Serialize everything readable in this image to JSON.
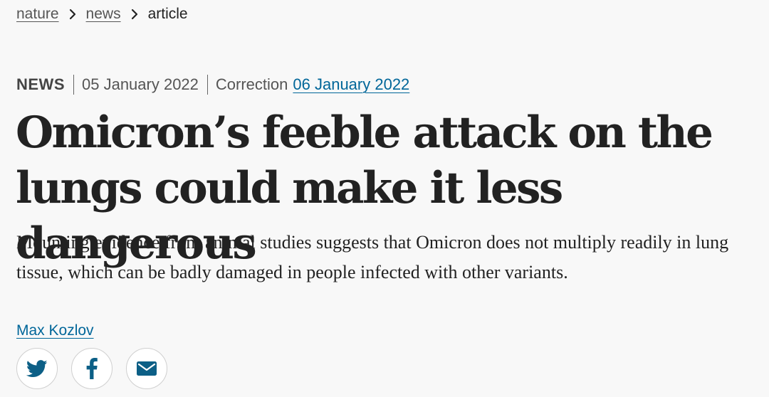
{
  "breadcrumb": {
    "items": [
      {
        "label": "nature"
      },
      {
        "label": "news"
      }
    ],
    "current": "article"
  },
  "meta": {
    "type": "NEWS",
    "published_date": "05 January 2022",
    "correction_label": "Correction",
    "correction_date": "06 January 2022"
  },
  "headline": {
    "line1": "Omicron’s feeble attack on the",
    "line2": "lungs could make it less dangerous"
  },
  "standfirst": "Mounting evidence from animal studies suggests that Omicron does not multiply readily in lung tissue, which can be badly damaged in people infected with other variants.",
  "author": "Max Kozlov",
  "share": {
    "buttons": [
      {
        "icon": "twitter-icon"
      },
      {
        "icon": "facebook-icon"
      },
      {
        "icon": "email-icon"
      }
    ]
  },
  "colors": {
    "link": "#006699",
    "icon": "#0c5f86",
    "text": "#222222",
    "background": "#f8f8f8"
  }
}
